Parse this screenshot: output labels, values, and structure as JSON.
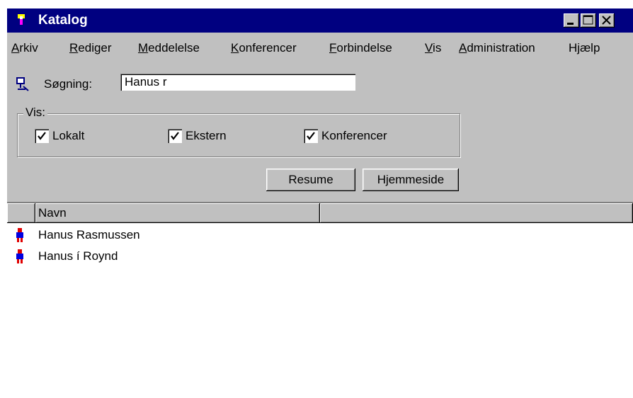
{
  "window": {
    "title": "Katalog"
  },
  "menu": {
    "items": [
      {
        "label": "Arkiv"
      },
      {
        "label": "Rediger"
      },
      {
        "label": "Meddelelse"
      },
      {
        "label": "Konferencer"
      },
      {
        "label": "Forbindelse"
      },
      {
        "label": "Vis"
      },
      {
        "label": "Administration"
      },
      {
        "label": "Hjælp"
      }
    ]
  },
  "search": {
    "label": "Søgning:",
    "value": "Hanus r"
  },
  "filter": {
    "legend": "Vis:",
    "options": [
      {
        "label": "Lokalt",
        "checked": true
      },
      {
        "label": "Ekstern",
        "checked": true
      },
      {
        "label": "Konferencer",
        "checked": true
      }
    ]
  },
  "buttons": {
    "resume": "Resume",
    "homepage": "Hjemmeside"
  },
  "list": {
    "columns": [
      "Navn"
    ],
    "rows": [
      {
        "name": "Hanus Rasmussen",
        "icon": "person-icon"
      },
      {
        "name": "Hanus í Roynd",
        "icon": "person-icon"
      }
    ]
  },
  "colors": {
    "titlebar": "#000080",
    "face": "#c0c0c0",
    "person_head": "#e00000",
    "person_body": "#0000e0"
  }
}
